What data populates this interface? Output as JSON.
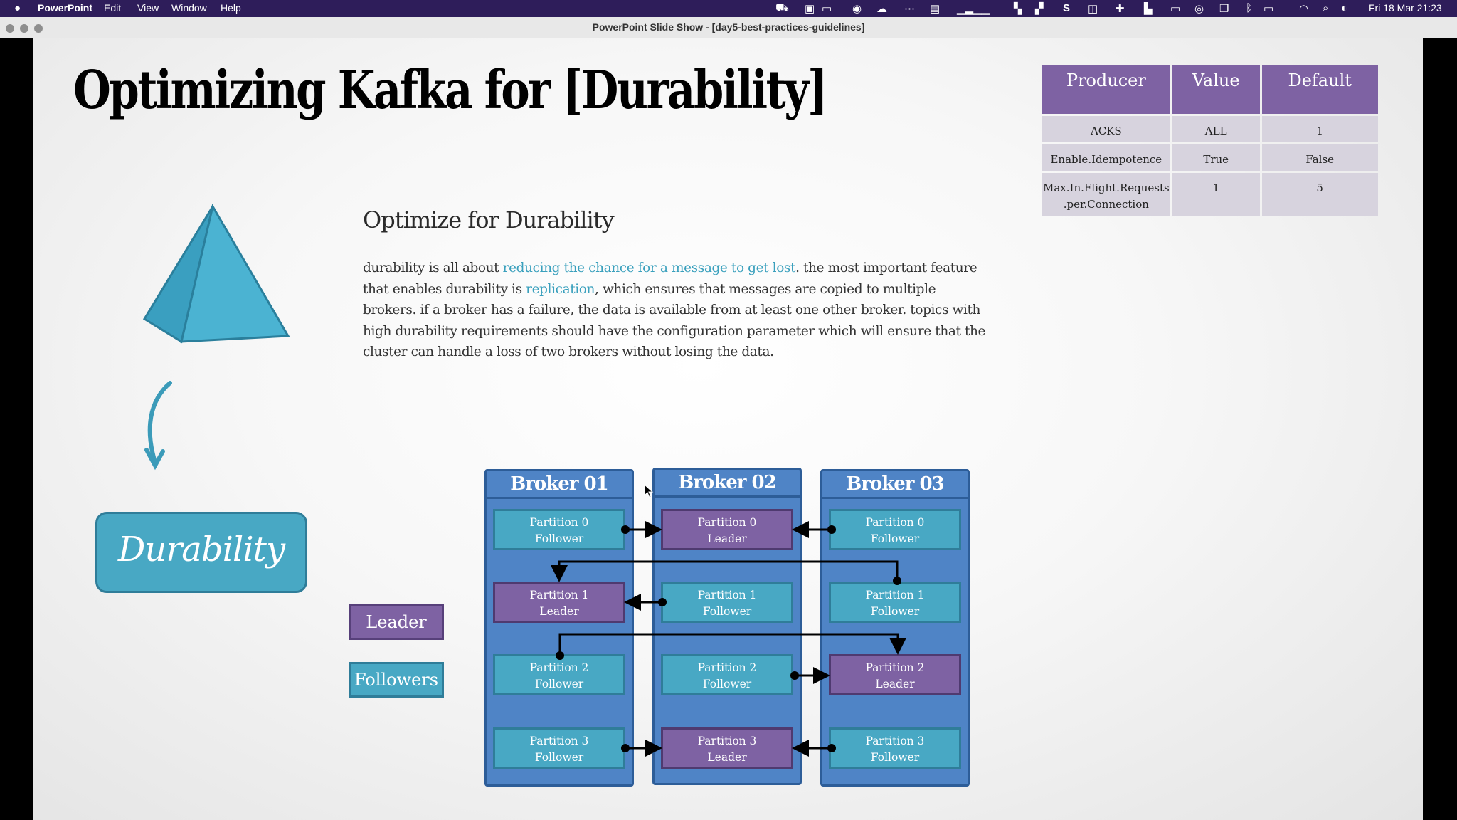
{
  "menubar": {
    "apple_icon": "apple-logo",
    "app_name": "PowerPoint",
    "menus": [
      "Edit",
      "View",
      "Window",
      "Help"
    ],
    "status_icons": [
      "car-icon",
      "screen-icon",
      "window-icon",
      "grammarly-icon",
      "cloud-icon",
      "dots-icon",
      "display-icon",
      "cpu-graph-icon",
      "chart-icon",
      "chart2-icon",
      "skype-icon",
      "cast-icon",
      "plus-icon",
      "layout-icon",
      "stack-icon",
      "play-icon",
      "copy-icon",
      "bluetooth-icon",
      "battery-icon",
      "wifi-icon",
      "search-icon",
      "control-center-icon"
    ],
    "clock": "Fri 18 Mar  21:23"
  },
  "window": {
    "title": "PowerPoint Slide Show - [day5-best-practices-guidelines]"
  },
  "slide": {
    "title": "Optimizing Kafka for [Durability]",
    "subtitle": "Optimize for Durability",
    "body": {
      "p1": "durability is all about ",
      "link1": "reducing the chance for a message to get lost",
      "p2": ". the most important feature that enables durability is ",
      "link2": "replication",
      "p3": ", which ensures that messages are copied to multiple brokers. if a broker has a failure, the data is available from at least one other broker. topics with high durability requirements should have the configuration parameter which will ensure that the cluster can handle a loss of two brokers without losing the data."
    },
    "badge": "Durability",
    "legend": {
      "leader": "Leader",
      "followers": "Followers"
    },
    "colors": {
      "leader": "#7e62a3",
      "follower": "#48a8c4",
      "broker": "#4f84c6",
      "accent_text": "#3aa0bd"
    },
    "brokers": [
      {
        "name": "Broker 01",
        "partitions": [
          {
            "line1": "Partition 0",
            "line2": "Follower",
            "role": "f"
          },
          {
            "line1": "Partition 1",
            "line2": "Leader",
            "role": "l"
          },
          {
            "line1": "Partition 2",
            "line2": "Follower",
            "role": "f"
          },
          {
            "line1": "Partition 3",
            "line2": "Follower",
            "role": "f"
          }
        ]
      },
      {
        "name": "Broker 02",
        "partitions": [
          {
            "line1": "Partition 0",
            "line2": "Leader",
            "role": "l"
          },
          {
            "line1": "Partition 1",
            "line2": "Follower",
            "role": "f"
          },
          {
            "line1": "Partition 2",
            "line2": "Follower",
            "role": "f"
          },
          {
            "line1": "Partition 3",
            "line2": "Leader",
            "role": "l"
          }
        ]
      },
      {
        "name": "Broker 03",
        "partitions": [
          {
            "line1": "Partition 0",
            "line2": "Follower",
            "role": "f"
          },
          {
            "line1": "Partition 1",
            "line2": "Follower",
            "role": "f"
          },
          {
            "line1": "Partition 2",
            "line2": "Leader",
            "role": "l"
          },
          {
            "line1": "Partition 3",
            "line2": "Follower",
            "role": "f"
          }
        ]
      }
    ],
    "config_table": {
      "headers": [
        "Producer",
        "Value",
        "Default"
      ],
      "rows": [
        [
          "ACKS",
          "ALL",
          "1"
        ],
        [
          "Enable.Idempotence",
          "True",
          "False"
        ],
        [
          "Max.In.Flight.Requests .per.Connection",
          "1",
          "5"
        ]
      ]
    }
  }
}
